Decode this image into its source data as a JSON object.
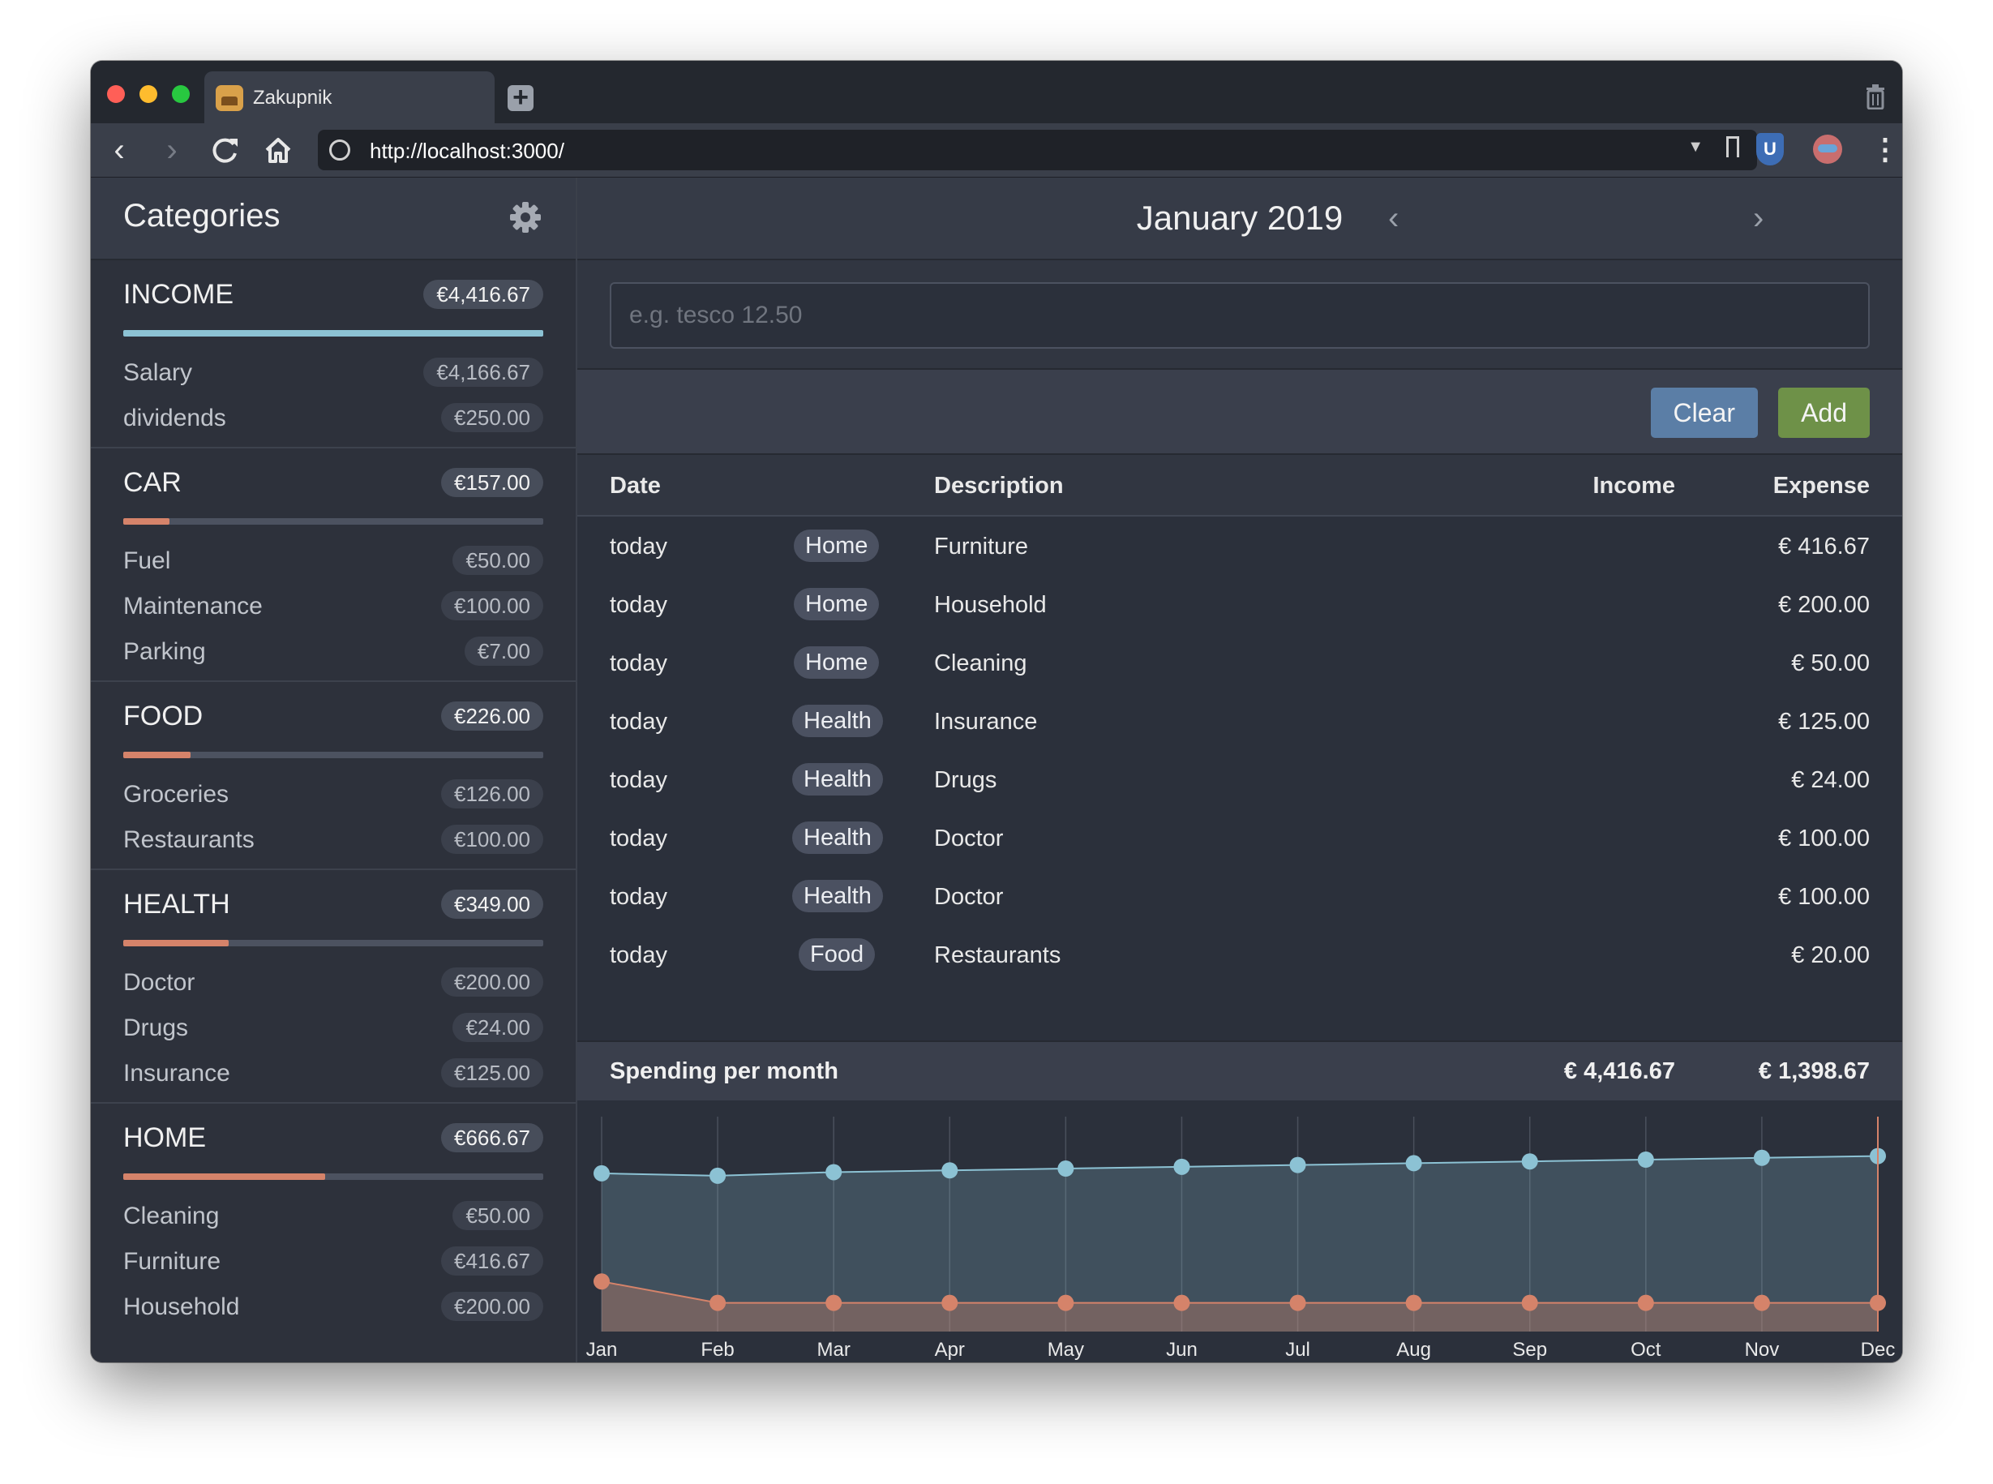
{
  "browser": {
    "tab_title": "Zakupnik",
    "url": "http://localhost:3000/"
  },
  "sidebar": {
    "title": "Categories",
    "groups": [
      {
        "name": "INCOME",
        "total": "€4,416.67",
        "fill": 1.0,
        "color": "#8cc2d4",
        "items": [
          {
            "name": "Salary",
            "amount": "€4,166.67"
          },
          {
            "name": "dividends",
            "amount": "€250.00"
          }
        ]
      },
      {
        "name": "CAR",
        "total": "€157.00",
        "fill": 0.11,
        "color": "#d5836a",
        "items": [
          {
            "name": "Fuel",
            "amount": "€50.00"
          },
          {
            "name": "Maintenance",
            "amount": "€100.00"
          },
          {
            "name": "Parking",
            "amount": "€7.00"
          }
        ]
      },
      {
        "name": "FOOD",
        "total": "€226.00",
        "fill": 0.16,
        "color": "#d5836a",
        "items": [
          {
            "name": "Groceries",
            "amount": "€126.00"
          },
          {
            "name": "Restaurants",
            "amount": "€100.00"
          }
        ]
      },
      {
        "name": "HEALTH",
        "total": "€349.00",
        "fill": 0.25,
        "color": "#d5836a",
        "items": [
          {
            "name": "Doctor",
            "amount": "€200.00"
          },
          {
            "name": "Drugs",
            "amount": "€24.00"
          },
          {
            "name": "Insurance",
            "amount": "€125.00"
          }
        ]
      },
      {
        "name": "HOME",
        "total": "€666.67",
        "fill": 0.48,
        "color": "#d5836a",
        "items": [
          {
            "name": "Cleaning",
            "amount": "€50.00"
          },
          {
            "name": "Furniture",
            "amount": "€416.67"
          },
          {
            "name": "Household",
            "amount": "€200.00"
          }
        ]
      }
    ]
  },
  "main": {
    "month": "January 2019",
    "prev": "‹",
    "next": "›",
    "input_placeholder": "e.g. tesco 12.50",
    "clear_label": "Clear",
    "add_label": "Add",
    "columns": {
      "date": "Date",
      "description": "Description",
      "income": "Income",
      "expense": "Expense"
    },
    "rows": [
      {
        "date": "today",
        "tag": "Home",
        "description": "Furniture",
        "income": "",
        "expense": "€ 416.67"
      },
      {
        "date": "today",
        "tag": "Home",
        "description": "Household",
        "income": "",
        "expense": "€ 200.00"
      },
      {
        "date": "today",
        "tag": "Home",
        "description": "Cleaning",
        "income": "",
        "expense": "€ 50.00"
      },
      {
        "date": "today",
        "tag": "Health",
        "description": "Insurance",
        "income": "",
        "expense": "€ 125.00"
      },
      {
        "date": "today",
        "tag": "Health",
        "description": "Drugs",
        "income": "",
        "expense": "€ 24.00"
      },
      {
        "date": "today",
        "tag": "Health",
        "description": "Doctor",
        "income": "",
        "expense": "€ 100.00"
      },
      {
        "date": "today",
        "tag": "Health",
        "description": "Doctor",
        "income": "",
        "expense": "€ 100.00"
      },
      {
        "date": "today",
        "tag": "Food",
        "description": "Restaurants",
        "income": "",
        "expense": "€ 20.00"
      }
    ],
    "summary": {
      "label": "Spending per month",
      "income_total": "€ 4,416.67",
      "expense_total": "€ 1,398.67"
    }
  },
  "chart_data": {
    "type": "area",
    "categories": [
      "Jan",
      "Feb",
      "Mar",
      "Apr",
      "May",
      "Jun",
      "Jul",
      "Aug",
      "Sep",
      "Oct",
      "Nov",
      "Dec"
    ],
    "ylim": [
      0,
      6000
    ],
    "series": [
      {
        "values": [
          4417,
          4350,
          4450,
          4500,
          4550,
          4600,
          4650,
          4700,
          4750,
          4800,
          4850,
          4900
        ],
        "color": "#8cc2d4"
      },
      {
        "values": [
          1399,
          800,
          800,
          800,
          800,
          800,
          800,
          800,
          800,
          800,
          800,
          800
        ],
        "color": "#d5836a"
      }
    ]
  }
}
